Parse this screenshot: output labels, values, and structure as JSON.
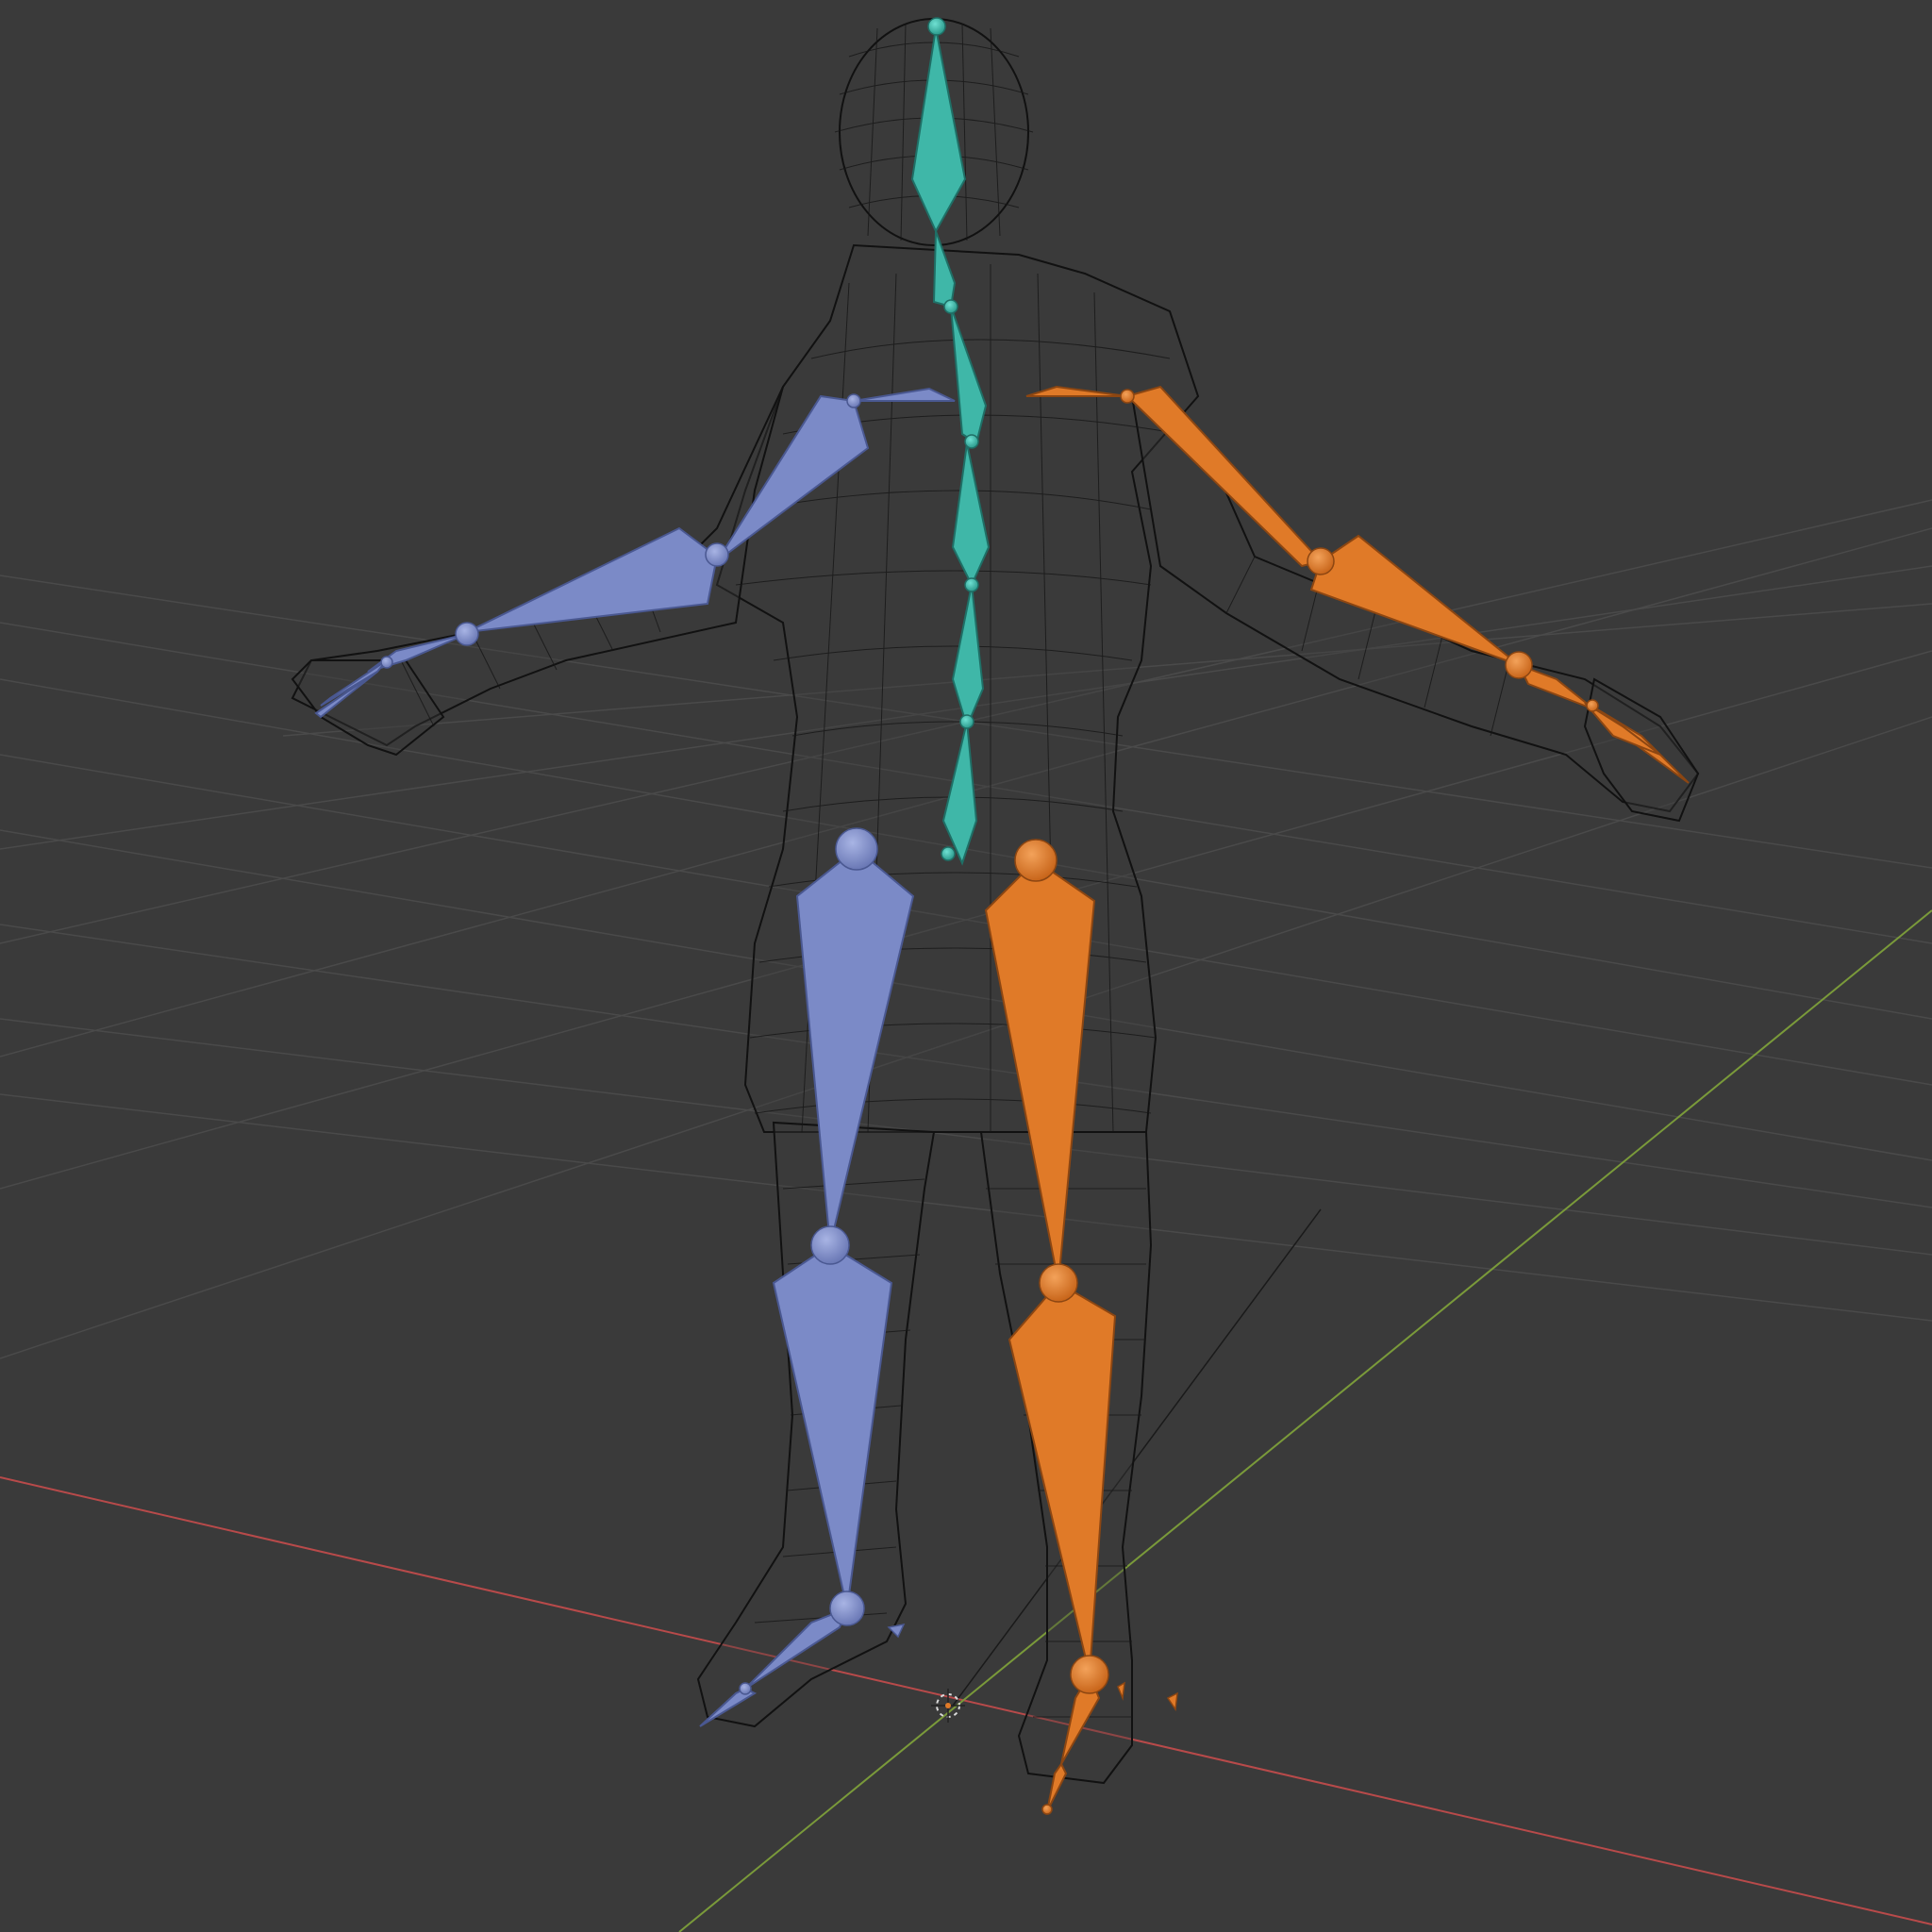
{
  "viewport": {
    "view": "3D Viewport",
    "shading": "wireframe",
    "object": "armature",
    "background_color": "#3a3a3a",
    "grid_color": "#4a4a4a",
    "x_axis_color": "#b84a4a",
    "y_axis_color": "#7a9a3a",
    "mesh_wire_color": "#111111"
  },
  "bone_colors": {
    "spine": "#3fb7a8",
    "left_side": "#7b8ac7",
    "right_side": "#e07a28"
  },
  "icons": {
    "origin": "3d-cursor-icon"
  }
}
